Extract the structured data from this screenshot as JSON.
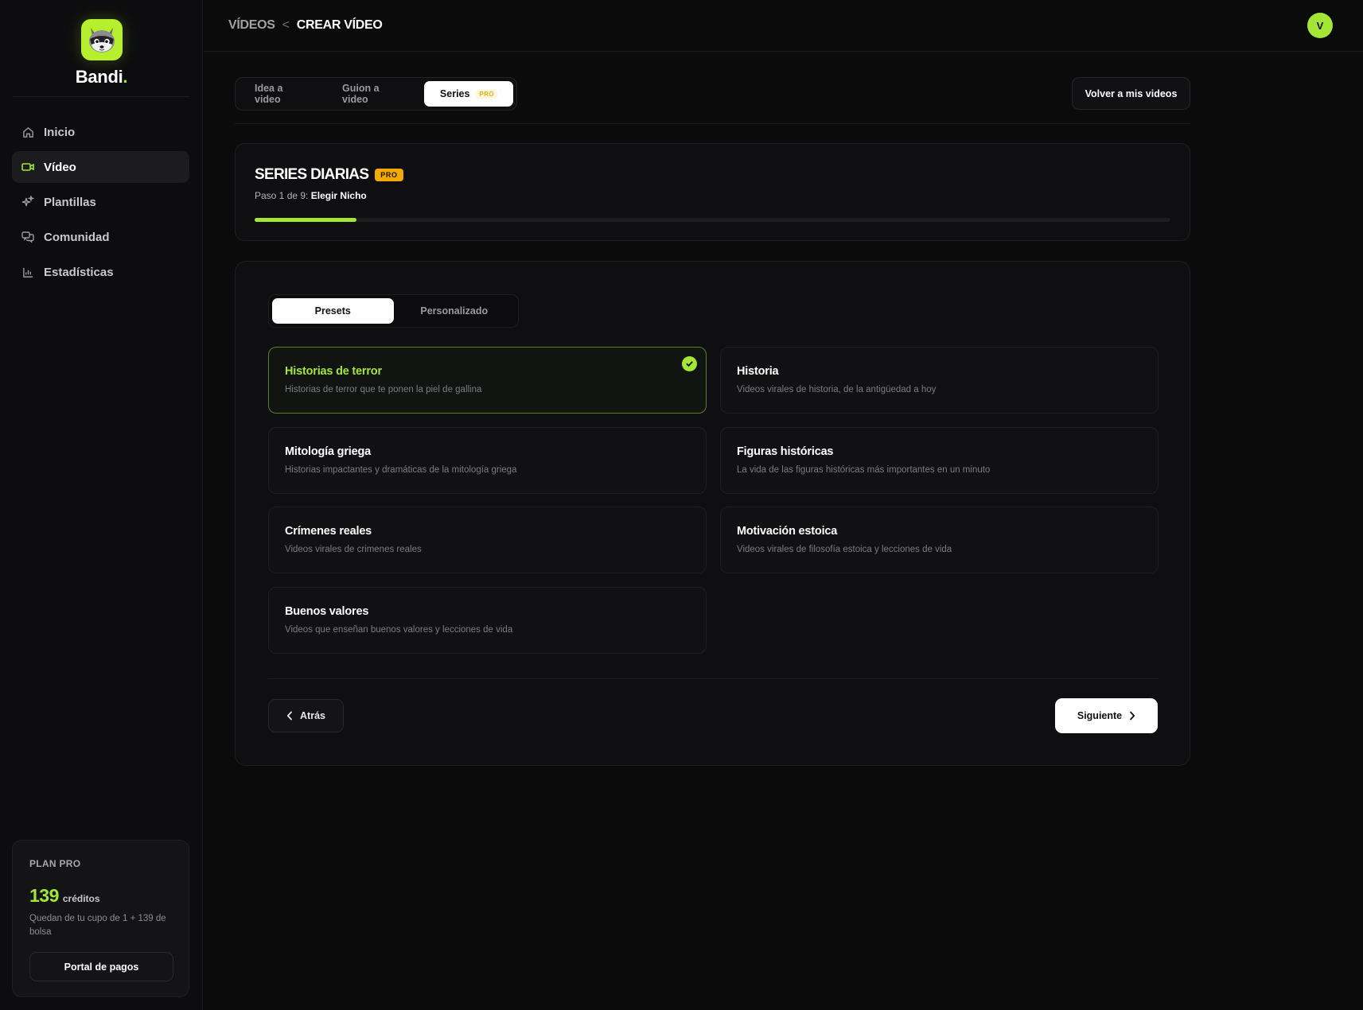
{
  "brand": {
    "name": "Bandi",
    "dot": "."
  },
  "nav": {
    "items": [
      {
        "label": "Inicio",
        "icon": "home-icon"
      },
      {
        "label": "Vídeo",
        "icon": "video-icon"
      },
      {
        "label": "Plantillas",
        "icon": "sparkles-icon"
      },
      {
        "label": "Comunidad",
        "icon": "chat-icon"
      },
      {
        "label": "Estadísticas",
        "icon": "bar-chart-icon"
      }
    ],
    "active_index": 1
  },
  "plan": {
    "title": "PLAN PRO",
    "credits": "139",
    "credits_unit": "créditos",
    "description": "Quedan de tu cupo de 1 + 139 de bolsa",
    "button": "Portal de pagos"
  },
  "header": {
    "crumb_1": "VÍDEOS",
    "separator": "<",
    "crumb_2": "CREAR VÍDEO",
    "avatar_initial": "V"
  },
  "mode_tabs": {
    "tab_1": "Idea a video",
    "tab_2": "Guion a video",
    "tab_3": "Series",
    "tab_3_badge": "PRO",
    "active": "Series"
  },
  "back_to_videos": "Volver a mis videos",
  "series": {
    "title": "SERIES DIARIAS",
    "badge": "PRO",
    "step_prefix": "Paso 1 de 9:",
    "step_name": "Elegir Nicho",
    "step_current": 1,
    "step_total": 9
  },
  "sub_tabs": {
    "presets": "Presets",
    "custom": "Personalizado",
    "active": "Presets"
  },
  "presets": [
    {
      "title": "Historias de terror",
      "description": "Historias de terror que te ponen la piel de gallina",
      "selected": true
    },
    {
      "title": "Historia",
      "description": "Videos virales de historia, de la antigüedad a hoy",
      "selected": false
    },
    {
      "title": "Mitología griega",
      "description": "Historias impactantes y dramáticas de la mitología griega",
      "selected": false
    },
    {
      "title": "Figuras históricas",
      "description": "La vida de las figuras históricas más importantes en un minuto",
      "selected": false
    },
    {
      "title": "Crímenes reales",
      "description": "Videos virales de crimenes reales",
      "selected": false
    },
    {
      "title": "Motivación estoica",
      "description": "Videos virales de filosofía estoica y lecciones de vida",
      "selected": false
    },
    {
      "title": "Buenos valores",
      "description": "Videos que enseñan buenos valores y lecciones de vida",
      "selected": false
    }
  ],
  "actions": {
    "back": "Atrás",
    "next": "Siguiente"
  },
  "colors": {
    "accent": "#a3e635",
    "pro_badge": "#f2a900",
    "background": "#0b0b0c",
    "panel": "#0f0f11"
  }
}
